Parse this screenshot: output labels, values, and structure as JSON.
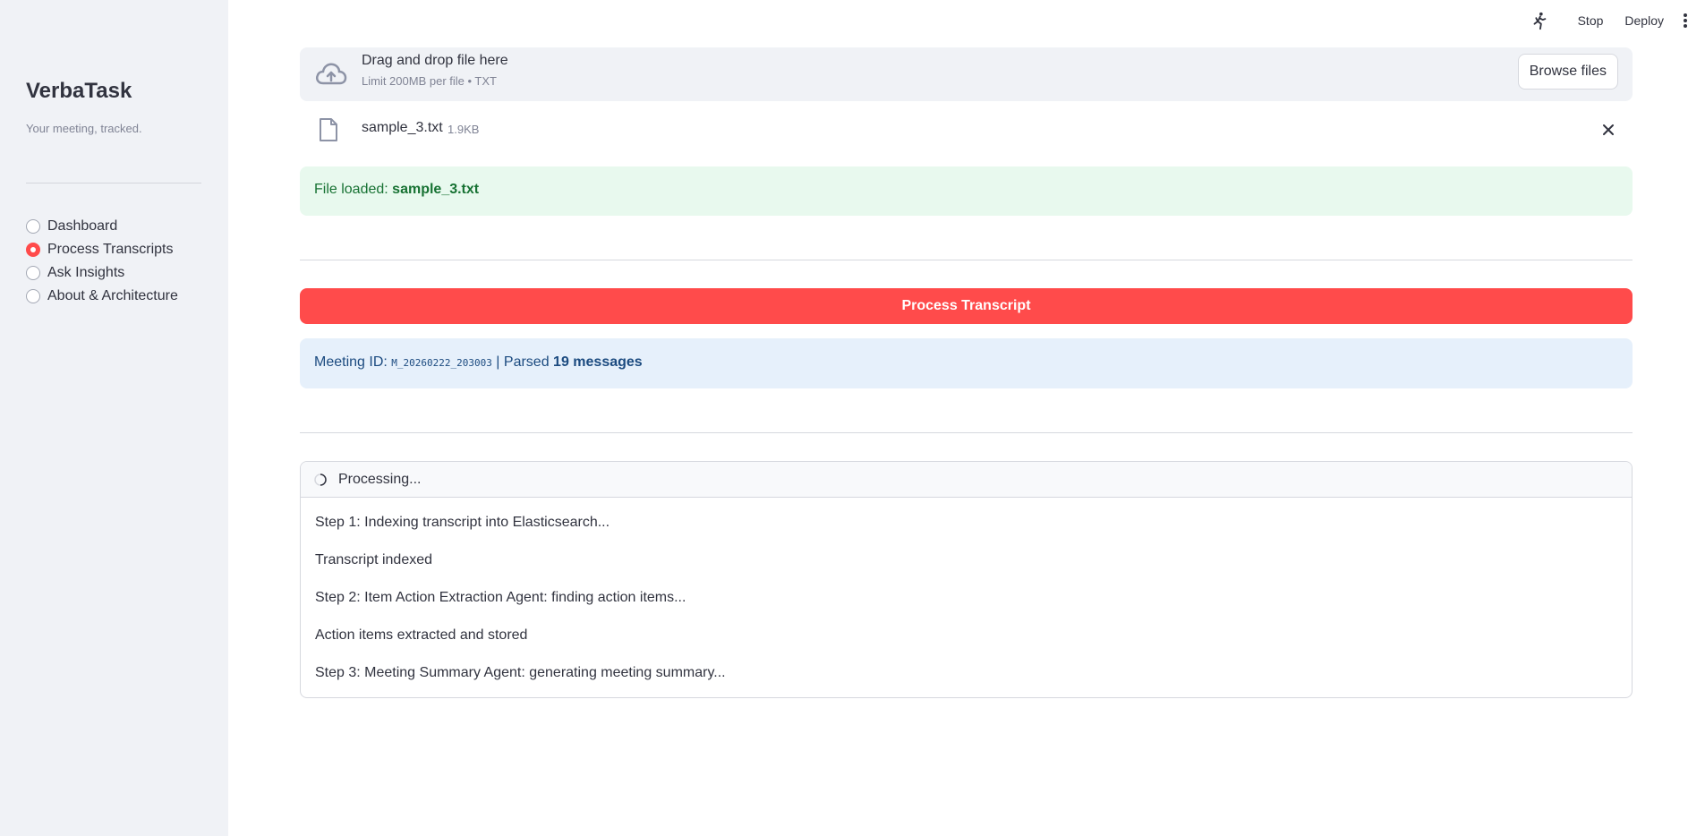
{
  "sidebar": {
    "title": "VerbaTask",
    "tagline": "Your meeting, tracked.",
    "nav": [
      {
        "label": "Dashboard",
        "selected": false
      },
      {
        "label": "Process Transcripts",
        "selected": true
      },
      {
        "label": "Ask Insights",
        "selected": false
      },
      {
        "label": "About & Architecture",
        "selected": false
      }
    ]
  },
  "toolbar": {
    "running_icon": "running-man-icon",
    "stop_label": "Stop",
    "deploy_label": "Deploy",
    "menu_icon": "kebab-menu-icon"
  },
  "uploader": {
    "icon": "cloud-upload-icon",
    "title": "Drag and drop file here",
    "limit": "Limit 200MB per file • TXT",
    "browse_label": "Browse files",
    "file": {
      "icon": "file-icon",
      "name": "sample_3.txt",
      "size": "1.9KB",
      "remove_icon": "close-icon"
    }
  },
  "success": {
    "prefix": "File loaded: ",
    "filename": "sample_3.txt",
    "color": "#177233",
    "background": "#e8f9ee"
  },
  "process_button": {
    "label": "Process Transcript",
    "color": "#ff4b4b"
  },
  "info": {
    "meeting_label": "Meeting ID: ",
    "meeting_id": "M_20260222_203003",
    "separator": " | Parsed ",
    "messages": "19 messages"
  },
  "status": {
    "icon": "spinner-icon",
    "header": "Processing...",
    "steps": [
      "Step 1: Indexing transcript into Elasticsearch...",
      "Transcript indexed",
      "Step 2: Item Action Extraction Agent: finding action items...",
      "Action items extracted and stored",
      "Step 3: Meeting Summary Agent: generating meeting summary..."
    ]
  }
}
